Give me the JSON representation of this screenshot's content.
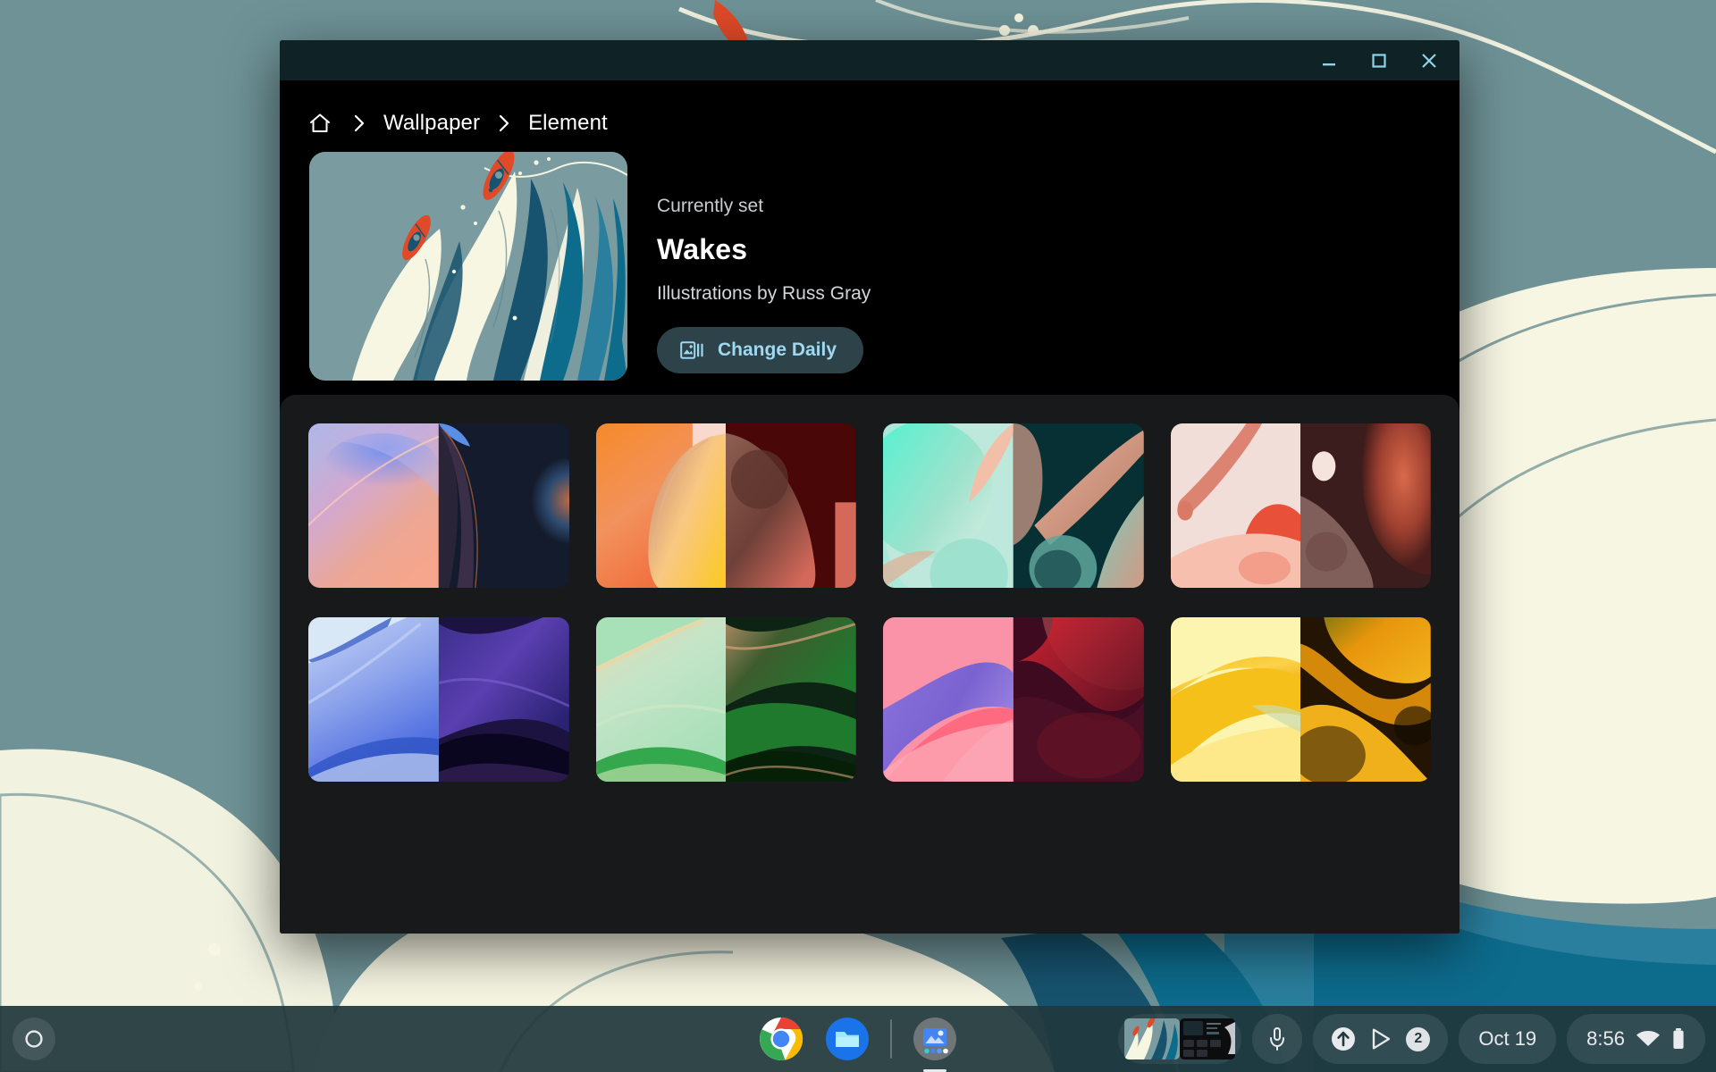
{
  "desktop": {
    "wallpaper_name": "Wakes",
    "colors": {
      "sky": "#6e9296",
      "cream": "#f7f6e3",
      "mid_blue": "#2a7f9e",
      "deep_blue": "#0d6b8c",
      "dark_blue": "#17536e",
      "teal_shade": "#5d868b",
      "kayak": "#e04a28",
      "line": "#4c7b82"
    }
  },
  "window": {
    "titlebar": {
      "background": "#0f2226",
      "control_color": "#8fd4ea"
    },
    "controls": [
      {
        "name": "minimize",
        "glyph": "minimize-icon"
      },
      {
        "name": "maximize",
        "glyph": "maximize-icon"
      },
      {
        "name": "close",
        "glyph": "close-icon"
      }
    ]
  },
  "breadcrumb": {
    "home_icon": "home-icon",
    "separator": "›",
    "items": [
      {
        "label": "Wallpaper",
        "current": false
      },
      {
        "label": "Element",
        "current": true
      }
    ]
  },
  "hero": {
    "status_label": "Currently set",
    "wallpaper_title": "Wakes",
    "attribution": "Illustrations by Russ Gray",
    "change_daily": {
      "label": "Change Daily",
      "icon": "slideshow-image-icon",
      "text_color": "#9fd8ef",
      "background": "#2d4349"
    }
  },
  "grid": {
    "panel_background": "#17191b",
    "columns": 4,
    "tiles": [
      {
        "name": "wallpaper-tile-1",
        "light": {
          "c1": "#a9b9e8",
          "c2": "#d9a8c8",
          "c3": "#f0a58e",
          "c4": "#6d8ff0"
        },
        "dark": {
          "c1": "#141b2c",
          "c2": "#2a2438",
          "c3": "#b5633f",
          "c4": "#5a8fe8"
        }
      },
      {
        "name": "wallpaper-tile-2",
        "light": {
          "c1": "#f58a2a",
          "c2": "#ffd27a",
          "c3": "#fbc25c",
          "c4": "#f9d9cf"
        },
        "dark": {
          "c1": "#4a0707",
          "c2": "#8d5f52",
          "c3": "#d4695a",
          "c4": "#2b0505"
        }
      },
      {
        "name": "wallpaper-tile-3",
        "light": {
          "c1": "#5cf0d0",
          "c2": "#bfe8dc",
          "c3": "#f2bfa8",
          "c4": "#9ae0cc"
        },
        "dark": {
          "c1": "#063034",
          "c2": "#d99e86",
          "c3": "#7fc9bb",
          "c4": "#022226"
        }
      },
      {
        "name": "wallpaper-tile-4",
        "light": {
          "c1": "#f2ded8",
          "c2": "#e8958a",
          "c3": "#f7c0ae",
          "c4": "#e8503a"
        },
        "dark": {
          "c1": "#3a1d1c",
          "c2": "#b5442c",
          "c3": "#d96a4a",
          "c4": "#f5e3de"
        }
      },
      {
        "name": "wallpaper-tile-5",
        "light": {
          "c1": "#d9e8f7",
          "c2": "#8fa5ec",
          "c3": "#4a6ae0",
          "c4": "#2f54c4"
        },
        "dark": {
          "c1": "#1c1340",
          "c2": "#3b2f8c",
          "c3": "#5a3fb0",
          "c4": "#0b0620"
        }
      },
      {
        "name": "wallpaper-tile-6",
        "light": {
          "c1": "#a8e0b8",
          "c2": "#e0dcb0",
          "c3": "#1f9e3a",
          "c4": "#cfe8c4"
        },
        "dark": {
          "c1": "#0d2414",
          "c2": "#1f7a2e",
          "c3": "#b08a66",
          "c4": "#062008"
        }
      },
      {
        "name": "wallpaper-tile-7",
        "light": {
          "c1": "#fb93a8",
          "c2": "#7a63d0",
          "c3": "#ff5c72",
          "c4": "#fca8b6"
        },
        "dark": {
          "c1": "#3d0a20",
          "c2": "#a81f2e",
          "c3": "#e0222e",
          "c4": "#250514"
        }
      },
      {
        "name": "wallpaper-tile-8",
        "light": {
          "c1": "#fbf5b0",
          "c2": "#f5c01a",
          "c3": "#fde98a",
          "c4": "#c9dcb0"
        },
        "dark": {
          "c1": "#241404",
          "c2": "#e8960c",
          "c3": "#f0b01c",
          "c4": "#120a02"
        }
      }
    ]
  },
  "shelf": {
    "launcher": {
      "name": "launcher-button",
      "icon": "circle-icon"
    },
    "apps": [
      {
        "name": "chrome",
        "label": "Chrome",
        "icon": "chrome-icon",
        "active": false
      },
      {
        "name": "files",
        "label": "Files",
        "icon": "folder-icon",
        "active": false
      },
      {
        "name": "wallpaper",
        "label": "Wallpaper",
        "icon": "wallpaper-app-icon",
        "active": true
      }
    ],
    "window_previews": [
      {
        "name": "preview-wakes-wallpaper",
        "icon": "wallpaper-preview"
      },
      {
        "name": "preview-wallpaper-app",
        "icon": "app-window-preview"
      }
    ],
    "mic": {
      "name": "mic-button",
      "icon": "microphone-icon"
    },
    "tray": {
      "items": [
        {
          "name": "upload-icon",
          "icon": "arrow-up-circle-icon"
        },
        {
          "name": "play-store-icon",
          "icon": "play-triangle-icon"
        }
      ],
      "badge_count": "2"
    },
    "date": "Oct 19",
    "time": "8:56",
    "status_icons": [
      {
        "name": "wifi-icon",
        "icon": "wifi-icon"
      },
      {
        "name": "battery-icon",
        "icon": "battery-icon"
      }
    ]
  }
}
